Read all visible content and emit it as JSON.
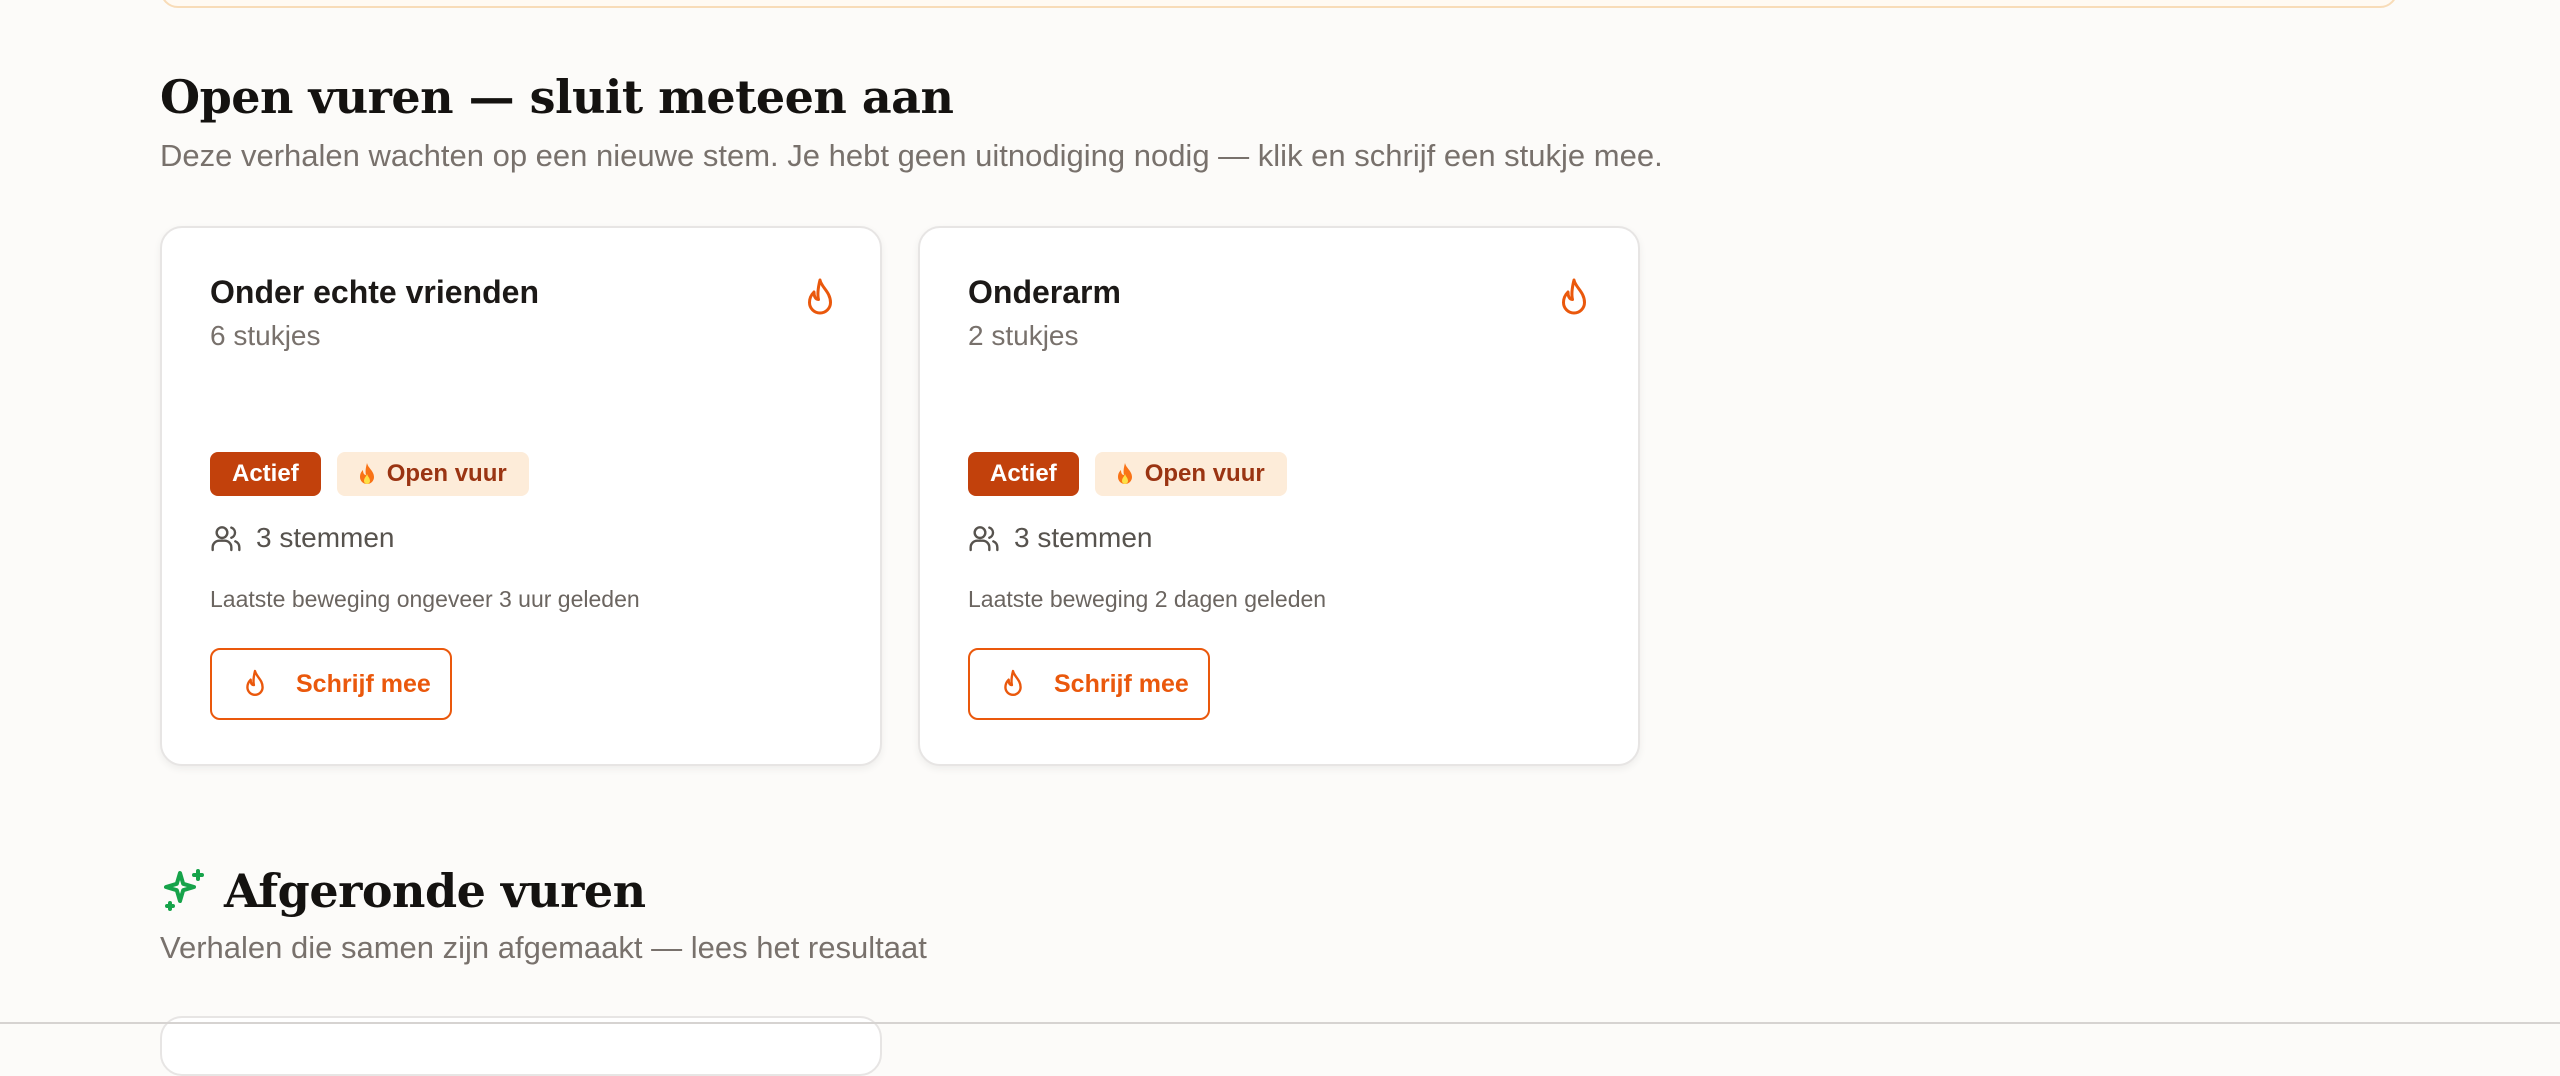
{
  "open_fires": {
    "title": "Open vuren — sluit meteen aan",
    "subtitle": "Deze verhalen wachten op een nieuwe stem. Je hebt geen uitnodiging nodig — klik en schrijf een stukje mee.",
    "cards": [
      {
        "title": "Onder echte vrienden",
        "pieces": "6 stukjes",
        "badge_active": "Actief",
        "badge_open": "Open vuur",
        "voices": "3 stemmen",
        "activity": "Laatste beweging ongeveer 3 uur geleden",
        "button": "Schrijf mee"
      },
      {
        "title": "Onderarm",
        "pieces": "2 stukjes",
        "badge_active": "Actief",
        "badge_open": "Open vuur",
        "voices": "3 stemmen",
        "activity": "Laatste beweging 2 dagen geleden",
        "button": "Schrijf mee"
      }
    ]
  },
  "finished": {
    "title": "Afgeronde vuren",
    "subtitle": "Verhalen die samen zijn afgemaakt — lees het resultaat"
  },
  "icons": {
    "flame": "flame-icon",
    "users": "users-icon",
    "sparkles": "sparkles-icon"
  },
  "colors": {
    "accent": "#ea580c",
    "badge_active_bg": "#c2410c",
    "badge_open_bg": "#fdecd9",
    "sparkles": "#16a34a"
  }
}
